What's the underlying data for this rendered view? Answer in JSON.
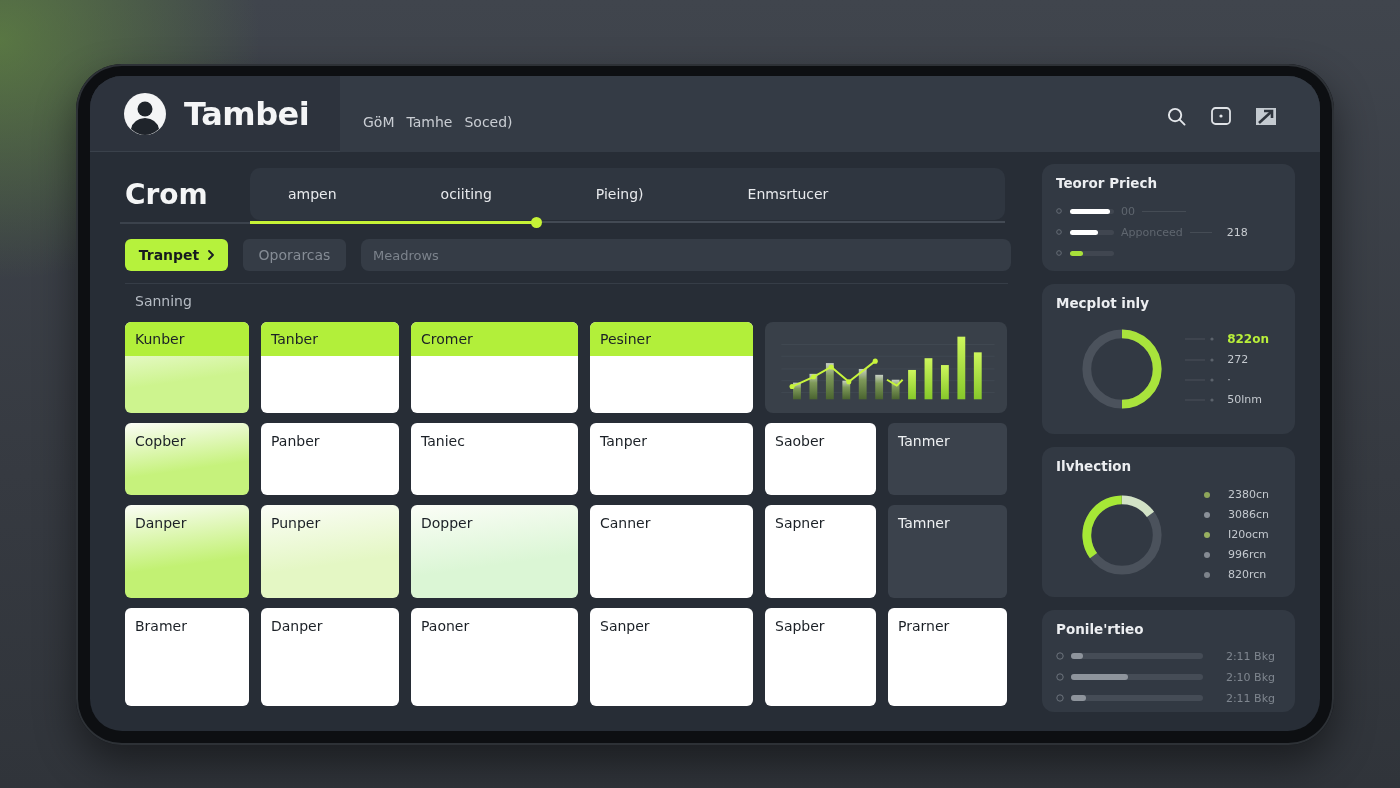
{
  "header": {
    "brand": "Tambei",
    "nav": [
      "GöM",
      "Tamhe",
      "Soced)"
    ]
  },
  "main": {
    "title": "Crom",
    "tabs": [
      "ampen",
      "ociiting",
      "Pieing)",
      "Enmsrtucer"
    ],
    "progress": {
      "level": 0.38
    },
    "actions": [
      {
        "label": "Tranpet",
        "kind": "primary"
      },
      {
        "label": "Oporarcas",
        "kind": "secondary"
      }
    ],
    "search": {
      "placeholder": "Meadrows"
    },
    "section_label": "Sanning",
    "cards": [
      {
        "kind": "banner",
        "label": "Kunber",
        "color": "#cdf48e"
      },
      {
        "kind": "banner",
        "label": "Tanber"
      },
      {
        "kind": "banner",
        "label": "Cromer"
      },
      {
        "kind": "banner",
        "label": "Pesiner"
      },
      {
        "kind": "chart"
      },
      {
        "kind": "card",
        "label": "Copber",
        "color": "#c6f27c"
      },
      {
        "kind": "card",
        "label": "Panber"
      },
      {
        "kind": "card",
        "label": "Taniec"
      },
      {
        "kind": "card",
        "label": "Tanper"
      },
      {
        "kind": "card",
        "label": "Saober"
      },
      {
        "kind": "dark",
        "label": "Tanmer"
      },
      {
        "kind": "card",
        "label": "Danper",
        "color": "#c2f173"
      },
      {
        "kind": "card",
        "label": "Punper",
        "color": "#e4f7c4"
      },
      {
        "kind": "card",
        "label": "Dopper",
        "color": "#dbf6d5"
      },
      {
        "kind": "card",
        "label": "Canner"
      },
      {
        "kind": "card",
        "label": "Sapner"
      },
      {
        "kind": "dark",
        "label": "Tamner"
      },
      {
        "kind": "card",
        "label": "Bramer"
      },
      {
        "kind": "card",
        "label": "Danper"
      },
      {
        "kind": "card",
        "label": "Paoner"
      },
      {
        "kind": "card",
        "label": "Sanper"
      },
      {
        "kind": "card",
        "label": "Sapber"
      },
      {
        "kind": "card",
        "label": "Prarner"
      }
    ]
  },
  "side_panels": [
    {
      "kind": "bars",
      "title": "Teoror Priech",
      "rows": [
        {
          "level": 0.9,
          "color": "#ffffff",
          "label": "00"
        },
        {
          "level": 0.64,
          "color": "#ffffff",
          "label": "Apponceed",
          "value": "218"
        },
        {
          "level": 0.3,
          "color": "#a8e03a"
        }
      ]
    },
    {
      "kind": "meter",
      "title": "Mecplot inly",
      "level": 0.5,
      "legend": [
        {
          "value": "822on",
          "highlighted": true
        },
        {
          "value": "272",
          "highlighted": false
        },
        {
          "value": "·",
          "highlighted": false
        },
        {
          "value": "50lnm",
          "highlighted": false
        }
      ]
    },
    {
      "kind": "donut",
      "title": "Ilvhection",
      "legend": [
        {
          "value": "2380cn",
          "color": "#8ea65a"
        },
        {
          "value": "3086cn",
          "color": "#8a9098"
        },
        {
          "value": "I20ocm",
          "color": "#98b060"
        },
        {
          "value": "996rcn",
          "color": "#858b93"
        },
        {
          "value": "820rcn",
          "color": "#7d838b"
        }
      ]
    },
    {
      "kind": "progress",
      "title": "Ponile'rtieo",
      "rows": [
        {
          "level": 0.09,
          "value": "2:11 Bkg"
        },
        {
          "level": 0.43,
          "value": "2:10 Bkg"
        },
        {
          "level": 0.11,
          "value": "2:11 Bkg"
        }
      ]
    }
  ]
}
